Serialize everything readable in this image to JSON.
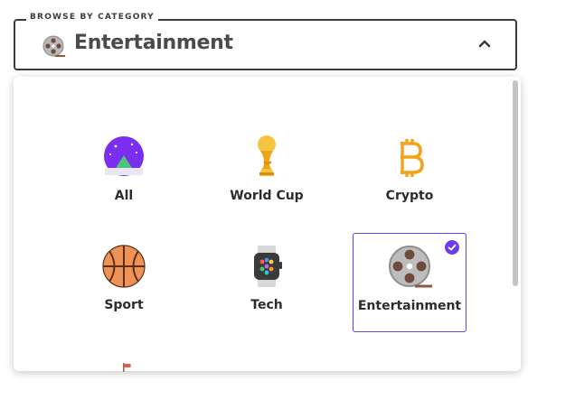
{
  "header": {
    "legend": "BROWSE BY CATEGORY",
    "selected": "Entertainment",
    "selected_icon": "film-reel-icon",
    "toggle_icon": "chevron-up-icon"
  },
  "categories": [
    {
      "label": "All",
      "icon": "globe-icon",
      "selected": false
    },
    {
      "label": "World Cup",
      "icon": "trophy-icon",
      "selected": false
    },
    {
      "label": "Crypto",
      "icon": "bitcoin-icon",
      "selected": false
    },
    {
      "label": "Sport",
      "icon": "basketball-icon",
      "selected": false
    },
    {
      "label": "Tech",
      "icon": "smartwatch-icon",
      "selected": false
    },
    {
      "label": "Entertainment",
      "icon": "film-reel-icon",
      "selected": true
    }
  ],
  "colors": {
    "accent": "#6c3ce9",
    "text": "#2c2c2c",
    "border": "#3b3b3b"
  }
}
